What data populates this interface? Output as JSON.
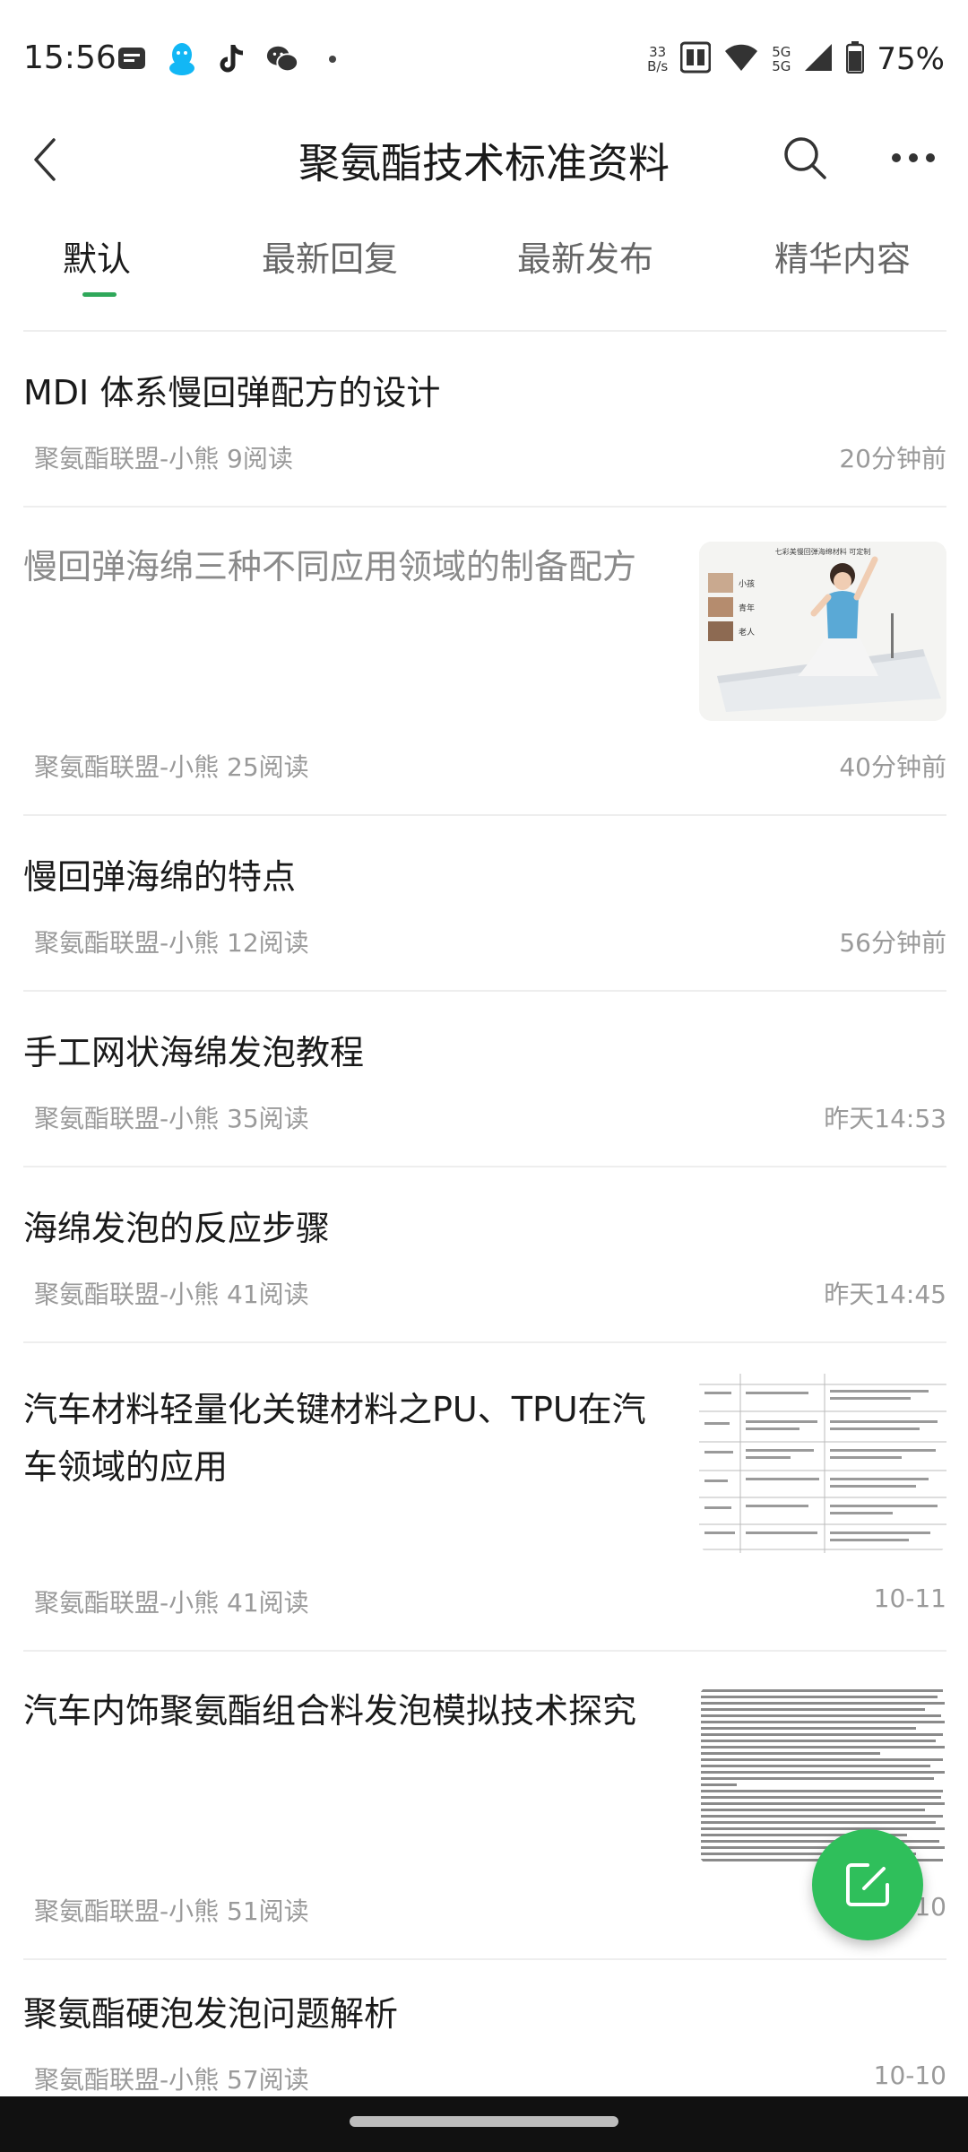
{
  "status_bar": {
    "time": "15:56",
    "net_speed_value": "33",
    "net_speed_unit": "B/s",
    "signal_label_1": "5G",
    "signal_label_2": "5G",
    "battery": "75%",
    "apps": [
      "message-icon",
      "qq-icon",
      "tiktok-icon",
      "wechat-icon",
      "dot-icon"
    ]
  },
  "header": {
    "title": "聚氨酯技术标准资料",
    "back_icon": "chevron-left-icon",
    "search_icon": "search-icon",
    "more_icon": "more-horizontal-icon"
  },
  "tabs": [
    {
      "label": "默认",
      "active": true
    },
    {
      "label": "最新回复",
      "active": false
    },
    {
      "label": "最新发布",
      "active": false
    },
    {
      "label": "精华内容",
      "active": false
    }
  ],
  "accent_color": "#2fa85a",
  "fab_color": "#2fbf5b",
  "posts": [
    {
      "title_lines": [
        "MDI 体系慢回弹配方的设计"
      ],
      "meta": "聚氨酯联盟-小熊 9阅读",
      "time": "20分钟前",
      "read": false,
      "thumbnail": null
    },
    {
      "title_lines": [
        "慢回弹海绵三种不同应用领域的制备配方"
      ],
      "meta": "聚氨酯联盟-小熊 25阅读",
      "time": "40分钟前",
      "read": true,
      "thumbnail": "mattress-photo",
      "thumb_caption": "七彩美慢回弹海绵材料 可定制",
      "thumb_labels": [
        "小孩",
        "青年",
        "老人"
      ]
    },
    {
      "title_lines": [
        "慢回弹海绵的特点"
      ],
      "meta": "聚氨酯联盟-小熊 12阅读",
      "time": "56分钟前",
      "read": false,
      "thumbnail": null
    },
    {
      "title_lines": [
        "手工网状海绵发泡教程"
      ],
      "meta": "聚氨酯联盟-小熊 35阅读",
      "time": "昨天14:53",
      "read": false,
      "thumbnail": null
    },
    {
      "title_lines": [
        "海绵发泡的反应步骤"
      ],
      "meta": "聚氨酯联盟-小熊 41阅读",
      "time": "昨天14:45",
      "read": false,
      "thumbnail": null
    },
    {
      "title_lines": [
        "汽车材料轻量化关键材料之PU、TPU在汽",
        "车领域的应用"
      ],
      "meta": "聚氨酯联盟-小熊 41阅读",
      "time": "10-11",
      "read": false,
      "thumbnail": "table-document"
    },
    {
      "title_lines": [
        "汽车内饰聚氨酯组合料发泡模拟技术探究"
      ],
      "meta": "聚氨酯联盟-小熊 51阅读",
      "time": "10",
      "read": false,
      "thumbnail": "text-document"
    },
    {
      "title_lines": [
        "聚氨酯硬泡发泡问题解析"
      ],
      "meta": "聚氨酯联盟-小熊 57阅读",
      "time": "10-10",
      "read": false,
      "thumbnail": null
    }
  ],
  "fab": {
    "icon": "compose-icon"
  }
}
